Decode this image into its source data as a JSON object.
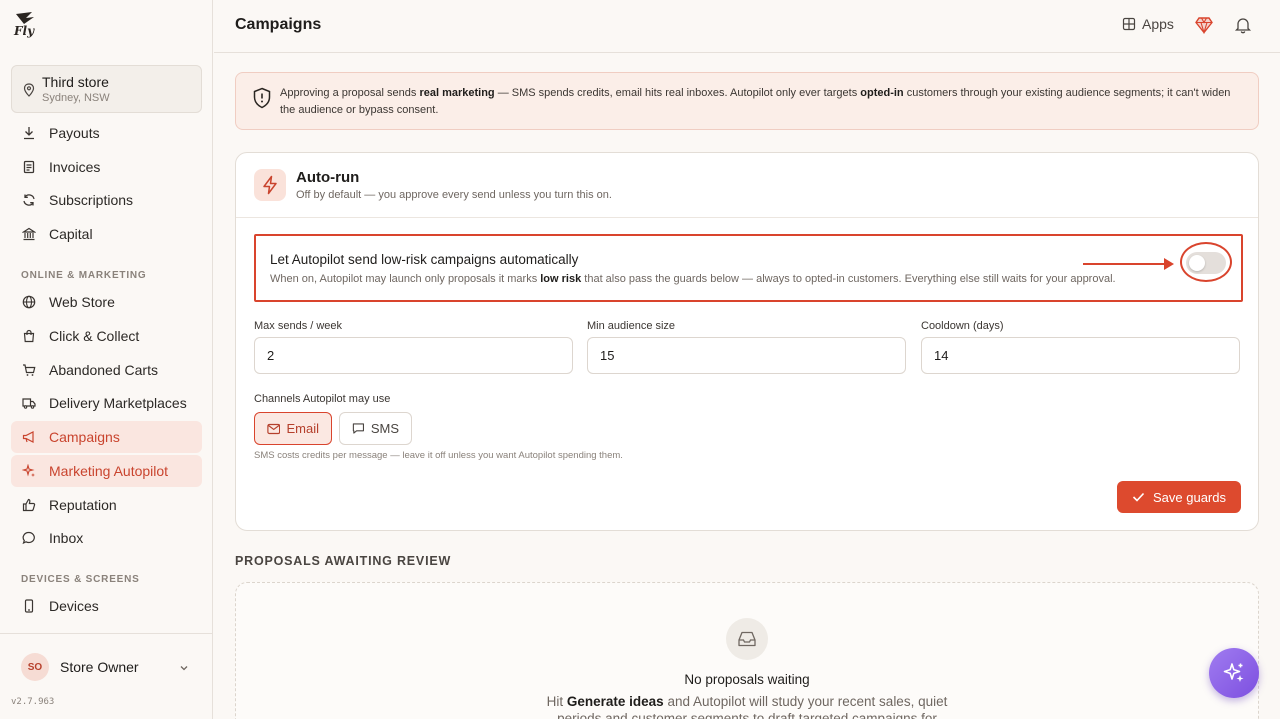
{
  "app": {
    "logo_text": "Fly"
  },
  "header": {
    "title": "Campaigns",
    "apps_label": "Apps"
  },
  "store": {
    "name": "Third store",
    "location": "Sydney, NSW"
  },
  "sidebar": {
    "items_top": [
      {
        "label": "Payouts",
        "icon": "download-icon"
      },
      {
        "label": "Invoices",
        "icon": "receipt-icon"
      },
      {
        "label": "Subscriptions",
        "icon": "refresh-icon"
      },
      {
        "label": "Capital",
        "icon": "bank-icon"
      }
    ],
    "section_online": "ONLINE & MARKETING",
    "items_online": [
      {
        "label": "Web Store",
        "icon": "globe-icon"
      },
      {
        "label": "Click & Collect",
        "icon": "shopping-bag-icon"
      },
      {
        "label": "Abandoned Carts",
        "icon": "cart-icon"
      },
      {
        "label": "Delivery Marketplaces",
        "icon": "truck-icon"
      },
      {
        "label": "Campaigns",
        "icon": "megaphone-icon",
        "active": true
      },
      {
        "label": "Marketing Autopilot",
        "icon": "sparkle-icon",
        "active": true
      },
      {
        "label": "Reputation",
        "icon": "thumbs-up-icon"
      },
      {
        "label": "Inbox",
        "icon": "chat-icon"
      }
    ],
    "section_devices": "DEVICES & SCREENS",
    "items_devices": [
      {
        "label": "Devices",
        "icon": "phone-icon"
      }
    ]
  },
  "footer": {
    "avatar_initials": "SO",
    "owner_name": "Store Owner",
    "version": "v2.7.963"
  },
  "notice": {
    "part1": "Approving a proposal sends ",
    "bold1": "real marketing",
    "part2": " — SMS spends credits, email hits real inboxes. Autopilot only ever targets ",
    "bold2": "opted-in",
    "part3": " customers through your existing audience segments; it can't widen the audience or bypass consent."
  },
  "autorun": {
    "title": "Auto-run",
    "subtitle": "Off by default — you approve every send unless you turn this on.",
    "toggle_title": "Let Autopilot send low-risk campaigns automatically",
    "toggle_desc_1": "When on, Autopilot may launch only proposals it marks ",
    "toggle_desc_bold": "low risk",
    "toggle_desc_2": " that also pass the guards below — always to opted-in customers. Everything else still waits for your approval.",
    "toggle_on": false
  },
  "guards": {
    "max_sends_label": "Max sends / week",
    "max_sends_value": "2",
    "min_audience_label": "Min audience size",
    "min_audience_value": "15",
    "cooldown_label": "Cooldown (days)",
    "cooldown_value": "14",
    "channels_label": "Channels Autopilot may use",
    "channel_email": "Email",
    "channel_sms": "SMS",
    "hint": "SMS costs credits per message — leave it off unless you want Autopilot spending them.",
    "save_label": "Save guards"
  },
  "proposals": {
    "heading": "PROPOSALS AWAITING REVIEW",
    "empty_title": "No proposals waiting",
    "empty_desc_1": "Hit ",
    "empty_desc_bold": "Generate ideas",
    "empty_desc_2": " and Autopilot will study your recent sales, quiet periods and customer segments to draft targeted campaigns for"
  },
  "colors": {
    "accent": "#dd4a2e",
    "highlight": "#d9442d",
    "fab": "#8a5ce8"
  }
}
